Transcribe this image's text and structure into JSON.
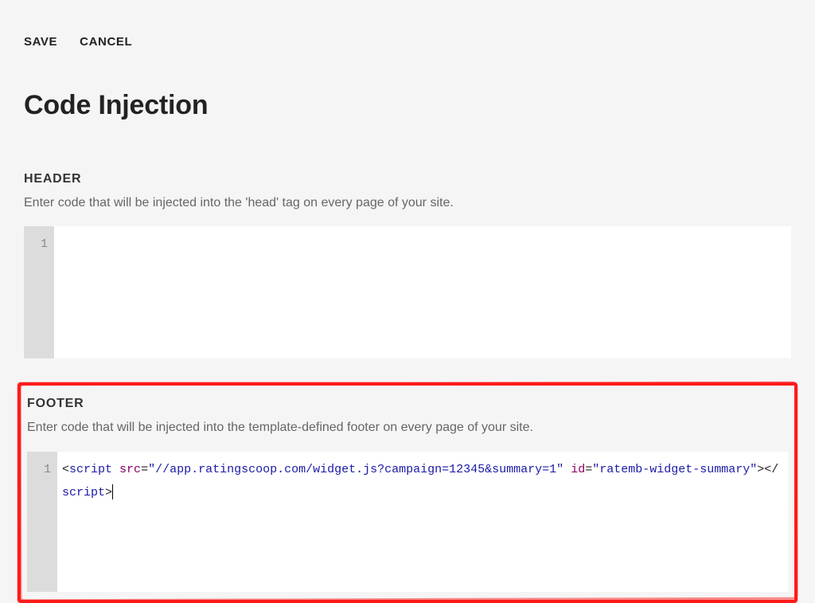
{
  "actions": {
    "save": "SAVE",
    "cancel": "CANCEL"
  },
  "page": {
    "title": "Code Injection"
  },
  "header_section": {
    "title": "HEADER",
    "desc": "Enter code that will be injected into the 'head' tag on every page of your site.",
    "gutter": "1",
    "code": ""
  },
  "footer_section": {
    "title": "FOOTER",
    "desc": "Enter code that will be injected into the template-defined footer on every page of your site.",
    "gutter": "1",
    "code_raw": "<script src=\"//app.ratingscoop.com/widget.js?campaign=12345&summary=1\" id=\"ratemb-widget-summary\"></script>",
    "tokens": {
      "open_lt": "<",
      "tag_open": "script",
      "sp1": " ",
      "attr1": "src",
      "eq1": "=",
      "str1": "\"//app.ratingscoop.com/widget.js?campaign=12345&summary=1\"",
      "sp2": " ",
      "attr2": "id",
      "eq2": "=",
      "str2": "\"ratemb-widget-summary\"",
      "gt1": ">",
      "close_lt": "</",
      "tag_close": "script",
      "gt2": ">"
    }
  }
}
